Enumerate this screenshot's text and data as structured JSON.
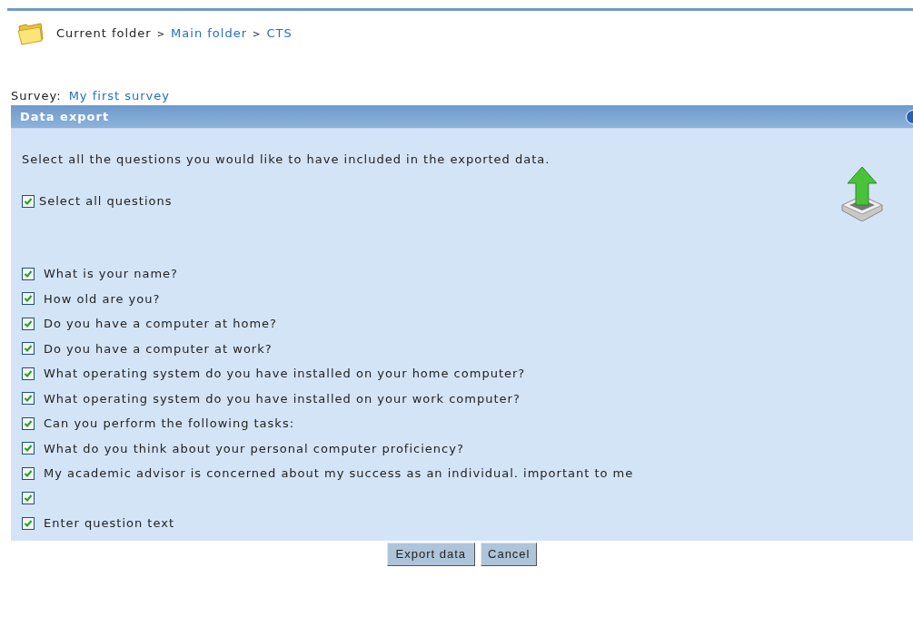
{
  "breadcrumb": {
    "label": "Current folder",
    "separator": ">",
    "links": [
      "Main folder",
      "CTS"
    ]
  },
  "survey": {
    "label": "Survey:",
    "link": "My first survey"
  },
  "panel": {
    "title": "Data export",
    "instruction": "Select all the questions you would like to have included in the exported data.",
    "select_all": {
      "label": "Select all questions",
      "checked": true
    },
    "questions": [
      {
        "text": "What is your name?",
        "checked": true
      },
      {
        "text": "How old are you?",
        "checked": true
      },
      {
        "text": "Do you have a computer at home?",
        "checked": true
      },
      {
        "text": "Do you have a computer at work?",
        "checked": true
      },
      {
        "text": "What operating system do you have installed on your home computer?",
        "checked": true
      },
      {
        "text": "What operating system do you have installed on your work computer?",
        "checked": true
      },
      {
        "text": "Can you perform the following tasks:",
        "checked": true
      },
      {
        "text": "What do you think about your personal computer proficiency?",
        "checked": true
      },
      {
        "text": "My academic advisor is concerned about my success as an individual. important to me",
        "checked": true
      },
      {
        "checked": true
      },
      {
        "text": "Enter question text",
        "checked": true
      }
    ]
  },
  "buttons": [
    "Export data",
    "Cancel"
  ]
}
